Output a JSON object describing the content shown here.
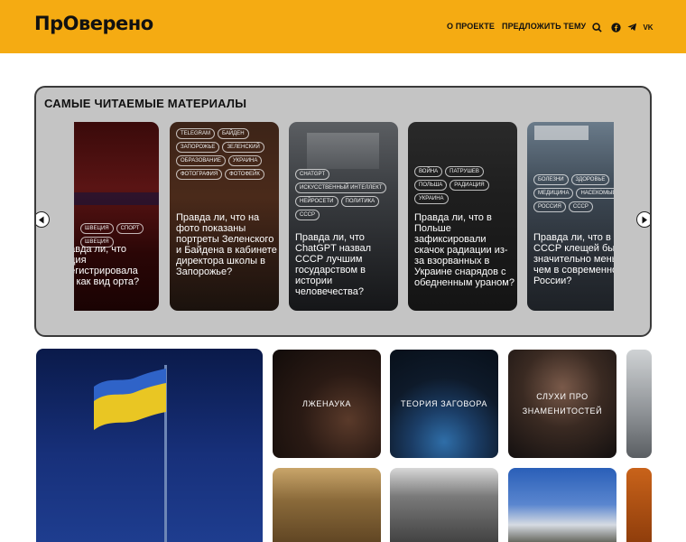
{
  "header": {
    "logo_text": "ПрОверено",
    "nav": {
      "about": "О ПРОЕКТЕ",
      "suggest": "ПРЕДЛОЖИТЬ ТЕМУ"
    },
    "social": {
      "vk": "VK"
    },
    "icons": [
      "search-icon",
      "facebook-icon",
      "telegram-icon",
      "vk-icon"
    ]
  },
  "most_read": {
    "title": "САМЫЕ ЧИТАЕМЫЕ МАТЕРИАЛЫ",
    "cards": [
      {
        "tags": [
          "ШВЕЦИЯ",
          "СПОРТ",
          "ШВЕЦИЯ"
        ],
        "title": "равда ли, что еция регистрировала кс как вид орта?"
      },
      {
        "tags": [
          "TELEGRAM",
          "БАЙДЕН",
          "ЗАПОРОЖЬЕ",
          "ЗЕЛЕНСКИЙ",
          "ОБРАЗОВАНИЕ",
          "УКРАИНА",
          "ФОТОГРАФИЯ",
          "ФОТОФЕЙК"
        ],
        "title": "Правда ли, что на фото показаны портреты Зеленского и Байдена в кабинете директора школы в Запорожье?"
      },
      {
        "tags": [
          "CHATGPT",
          "ИСКУССТВЕННЫЙ ИНТЕЛЛЕКТ",
          "НЕЙРОСЕТИ",
          "ПОЛИТИКА",
          "СССР"
        ],
        "title": "Правда ли, что ChatGPT назвал СССР лучшим государством в истории человечества?"
      },
      {
        "tags": [
          "ВОЙНА",
          "ПАТРУШЕВ",
          "ПОЛЬША",
          "РАДИАЦИЯ",
          "УКРАИНА"
        ],
        "title": "Правда ли, что в Польше зафиксировали скачок радиации из-за взорванных в Украине снарядов с обедненным ураном?"
      },
      {
        "tags": [
          "БОЛЕЗНИ",
          "ЗДОРОВЬЕ",
          "МЕДИЦИНА",
          "НАСЕКОМЫЕ",
          "РОССИЯ",
          "СССР"
        ],
        "title": "Правда ли, что в СССР клещей бы значительно меньше, чем в современной России?"
      }
    ]
  },
  "categories": [
    {
      "label": "ЛЖЕНАУКА"
    },
    {
      "label": "ТЕОРИЯ ЗАГОВОРА"
    },
    {
      "label": "СЛУХИ ПРО ЗНАМЕНИТОСТЕЙ"
    }
  ],
  "colors": {
    "accent": "#f5ab12",
    "panel": "#c4c4c4",
    "text": "#111111"
  }
}
